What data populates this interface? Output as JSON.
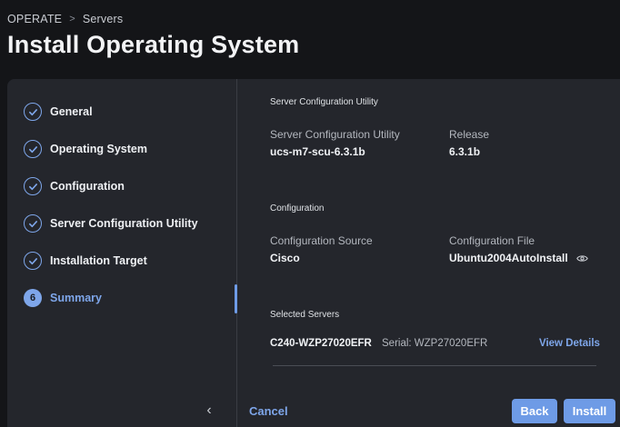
{
  "breadcrumb": {
    "root": "OPERATE",
    "current": "Servers"
  },
  "page_title": "Install Operating System",
  "steps": [
    {
      "label": "General",
      "state": "complete",
      "icon": "check-icon"
    },
    {
      "label": "Operating System",
      "state": "complete",
      "icon": "check-icon"
    },
    {
      "label": "Configuration",
      "state": "complete",
      "icon": "check-icon"
    },
    {
      "label": "Server Configuration Utility",
      "state": "complete",
      "icon": "check-icon"
    },
    {
      "label": "Installation Target",
      "state": "complete",
      "icon": "check-icon"
    },
    {
      "label": "Summary",
      "state": "active",
      "number": "6"
    }
  ],
  "scu": {
    "title": "Server Configuration Utility",
    "name_label": "Server Configuration Utility",
    "name_value": "ucs-m7-scu-6.3.1b",
    "release_label": "Release",
    "release_value": "6.3.1b"
  },
  "configuration": {
    "title": "Configuration",
    "source_label": "Configuration Source",
    "source_value": "Cisco",
    "file_label": "Configuration File",
    "file_value": "Ubuntu2004AutoInstall"
  },
  "servers": {
    "title": "Selected Servers",
    "items": [
      {
        "name": "C240-WZP27020EFR",
        "serial": "Serial: WZP27020EFR",
        "action": "View Details"
      }
    ]
  },
  "footer": {
    "cancel": "Cancel",
    "back": "Back",
    "install": "Install"
  },
  "colors": {
    "accent": "#6e9be6",
    "background": "#141518",
    "panel": "#24262c"
  }
}
